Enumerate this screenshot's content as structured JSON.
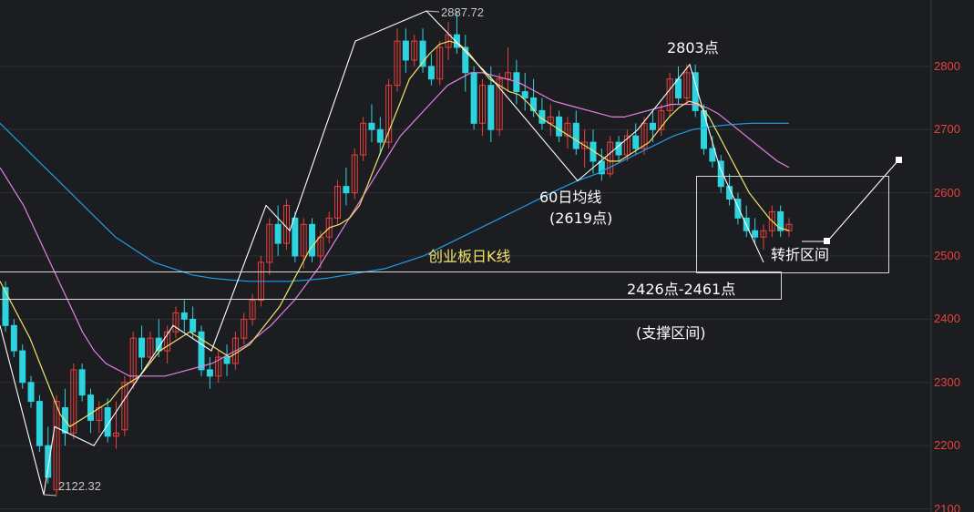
{
  "chart_data": {
    "type": "candlestick",
    "title": "创业板日K线",
    "y_ticks": [
      "2800",
      "2700",
      "2600",
      "2500",
      "2400",
      "2300",
      "2200",
      "2100"
    ],
    "y_tick_values": [
      2800,
      2700,
      2600,
      2500,
      2400,
      2300,
      2200,
      2100
    ],
    "ylim": [
      2095,
      2905
    ],
    "candles": [
      [
        2450,
        2460,
        2380,
        2390
      ],
      [
        2390,
        2400,
        2340,
        2350
      ],
      [
        2350,
        2360,
        2290,
        2300
      ],
      [
        2300,
        2310,
        2260,
        2270
      ],
      [
        2270,
        2280,
        2190,
        2200
      ],
      [
        2200,
        2230,
        2140,
        2150
      ],
      [
        2130,
        2280,
        2122.32,
        2270
      ],
      [
        2260,
        2290,
        2200,
        2220
      ],
      [
        2220,
        2330,
        2210,
        2320
      ],
      [
        2320,
        2330,
        2270,
        2280
      ],
      [
        2280,
        2290,
        2220,
        2240
      ],
      [
        2240,
        2270,
        2220,
        2260
      ],
      [
        2260,
        2275,
        2205,
        2215
      ],
      [
        2215,
        2270,
        2195,
        2220
      ],
      [
        2225,
        2310,
        2215,
        2300
      ],
      [
        2300,
        2380,
        2290,
        2370
      ],
      [
        2370,
        2390,
        2320,
        2340
      ],
      [
        2340,
        2380,
        2330,
        2370
      ],
      [
        2370,
        2400,
        2340,
        2350
      ],
      [
        2350,
        2390,
        2330,
        2380
      ],
      [
        2380,
        2420,
        2370,
        2410
      ],
      [
        2410,
        2430,
        2380,
        2400
      ],
      [
        2400,
        2420,
        2370,
        2380
      ],
      [
        2380,
        2390,
        2310,
        2320
      ],
      [
        2320,
        2340,
        2290,
        2310
      ],
      [
        2310,
        2350,
        2300,
        2340
      ],
      [
        2340,
        2360,
        2310,
        2330
      ],
      [
        2330,
        2380,
        2320,
        2370
      ],
      [
        2370,
        2410,
        2360,
        2400
      ],
      [
        2400,
        2440,
        2390,
        2430
      ],
      [
        2430,
        2500,
        2420,
        2490
      ],
      [
        2490,
        2560,
        2470,
        2550
      ],
      [
        2550,
        2580,
        2500,
        2520
      ],
      [
        2520,
        2590,
        2510,
        2580
      ],
      [
        2560,
        2570,
        2490,
        2500
      ],
      [
        2500,
        2560,
        2480,
        2550
      ],
      [
        2550,
        2560,
        2490,
        2500
      ],
      [
        2500,
        2540,
        2480,
        2530
      ],
      [
        2530,
        2570,
        2520,
        2560
      ],
      [
        2560,
        2620,
        2550,
        2610
      ],
      [
        2610,
        2640,
        2580,
        2600
      ],
      [
        2600,
        2670,
        2590,
        2660
      ],
      [
        2660,
        2720,
        2650,
        2710
      ],
      [
        2710,
        2740,
        2680,
        2700
      ],
      [
        2700,
        2720,
        2660,
        2680
      ],
      [
        2680,
        2780,
        2670,
        2770
      ],
      [
        2770,
        2860,
        2760,
        2840
      ],
      [
        2840,
        2860,
        2790,
        2810
      ],
      [
        2810,
        2850,
        2800,
        2840
      ],
      [
        2840,
        2860,
        2790,
        2800
      ],
      [
        2800,
        2820,
        2770,
        2780
      ],
      [
        2780,
        2840,
        2770,
        2830
      ],
      [
        2830,
        2870,
        2810,
        2850
      ],
      [
        2850,
        2887.72,
        2820,
        2830
      ],
      [
        2830,
        2850,
        2760,
        2790
      ],
      [
        2790,
        2800,
        2700,
        2710
      ],
      [
        2710,
        2780,
        2690,
        2770
      ],
      [
        2770,
        2800,
        2680,
        2700
      ],
      [
        2700,
        2790,
        2690,
        2780
      ],
      [
        2780,
        2830,
        2760,
        2790
      ],
      [
        2790,
        2810,
        2740,
        2760
      ],
      [
        2760,
        2790,
        2730,
        2750
      ],
      [
        2750,
        2780,
        2720,
        2730
      ],
      [
        2730,
        2750,
        2700,
        2710
      ],
      [
        2710,
        2740,
        2690,
        2720
      ],
      [
        2720,
        2730,
        2680,
        2690
      ],
      [
        2690,
        2720,
        2670,
        2710
      ],
      [
        2710,
        2730,
        2660,
        2670
      ],
      [
        2670,
        2700,
        2640,
        2680
      ],
      [
        2680,
        2700,
        2630,
        2650
      ],
      [
        2650,
        2670,
        2619,
        2630
      ],
      [
        2630,
        2690,
        2625,
        2680
      ],
      [
        2680,
        2690,
        2650,
        2660
      ],
      [
        2660,
        2700,
        2650,
        2690
      ],
      [
        2690,
        2710,
        2660,
        2670
      ],
      [
        2670,
        2720,
        2660,
        2710
      ],
      [
        2710,
        2730,
        2680,
        2700
      ],
      [
        2700,
        2740,
        2690,
        2730
      ],
      [
        2730,
        2790,
        2720,
        2780
      ],
      [
        2780,
        2800,
        2740,
        2750
      ],
      [
        2750,
        2803,
        2740,
        2790
      ],
      [
        2790,
        2803,
        2720,
        2730
      ],
      [
        2730,
        2740,
        2660,
        2670
      ],
      [
        2670,
        2690,
        2640,
        2650
      ],
      [
        2650,
        2660,
        2600,
        2610
      ],
      [
        2610,
        2630,
        2580,
        2590
      ],
      [
        2590,
        2600,
        2550,
        2560
      ],
      [
        2560,
        2580,
        2530,
        2540
      ],
      [
        2540,
        2560,
        2520,
        2530
      ],
      [
        2530,
        2550,
        2510,
        2540
      ],
      [
        2540,
        2580,
        2530,
        2570
      ],
      [
        2570,
        2580,
        2530,
        2540
      ],
      [
        2540,
        2560,
        2530,
        2550
      ]
    ],
    "ma5": [
      2460,
      2430,
      2400,
      2370,
      2330,
      2290,
      2250,
      2230,
      2240,
      2250,
      2260,
      2270,
      2290,
      2300,
      2310,
      2330,
      2350,
      2360,
      2370,
      2380,
      2370,
      2360,
      2350,
      2340,
      2350,
      2360,
      2380,
      2400,
      2420,
      2450,
      2480,
      2510,
      2530,
      2545,
      2550,
      2560,
      2580,
      2620,
      2660,
      2700,
      2740,
      2780,
      2800,
      2820,
      2835,
      2840,
      2835,
      2820,
      2800,
      2780,
      2770,
      2760,
      2755,
      2740,
      2720,
      2710,
      2700,
      2690,
      2680,
      2670,
      2660,
      2650,
      2650,
      2660,
      2670,
      2680,
      2700,
      2720,
      2735,
      2745,
      2740,
      2720,
      2690,
      2660,
      2630,
      2600,
      2580,
      2560,
      2545,
      2540
    ],
    "ma20": [
      2640,
      2610,
      2580,
      2540,
      2500,
      2460,
      2420,
      2380,
      2350,
      2330,
      2320,
      2310,
      2310,
      2310,
      2310,
      2315,
      2320,
      2325,
      2330,
      2340,
      2350,
      2360,
      2375,
      2390,
      2410,
      2430,
      2455,
      2480,
      2510,
      2540,
      2570,
      2600,
      2630,
      2660,
      2690,
      2710,
      2730,
      2750,
      2770,
      2780,
      2790,
      2790,
      2785,
      2780,
      2775,
      2765,
      2755,
      2745,
      2740,
      2735,
      2730,
      2725,
      2720,
      2720,
      2725,
      2730,
      2735,
      2740,
      2740,
      2740,
      2735,
      2725,
      2710,
      2695,
      2680,
      2665,
      2650,
      2640
    ],
    "ma60": [
      2710,
      2680,
      2650,
      2620,
      2590,
      2560,
      2530,
      2510,
      2490,
      2480,
      2470,
      2465,
      2462,
      2460,
      2460,
      2460,
      2462,
      2465,
      2470,
      2475,
      2480,
      2490,
      2500,
      2515,
      2530,
      2545,
      2560,
      2575,
      2590,
      2605,
      2619,
      2630,
      2645,
      2660,
      2675,
      2690,
      2700,
      2705,
      2708,
      2710,
      2710,
      2710
    ]
  },
  "labels": {
    "peak_high": "2887.72",
    "low": "2122.32",
    "peak2": "2803点",
    "ma60_label": "60日均线",
    "ma60_value": "(2619点)",
    "turn_zone": "转折区间",
    "support_range": "2426点-2461点",
    "support_zone": "(支撑区间)"
  },
  "colors": {
    "background": "#1c1d21",
    "up": "#e8413c",
    "down": "#2dd4e0",
    "ma5": "#ffffff",
    "ma10": "#f3e36a",
    "ma20": "#e580e5",
    "ma30": "#3fbf3f",
    "ma60": "#1e9ee8",
    "axis_text": "#e8413c",
    "grid": "#2e3036"
  }
}
